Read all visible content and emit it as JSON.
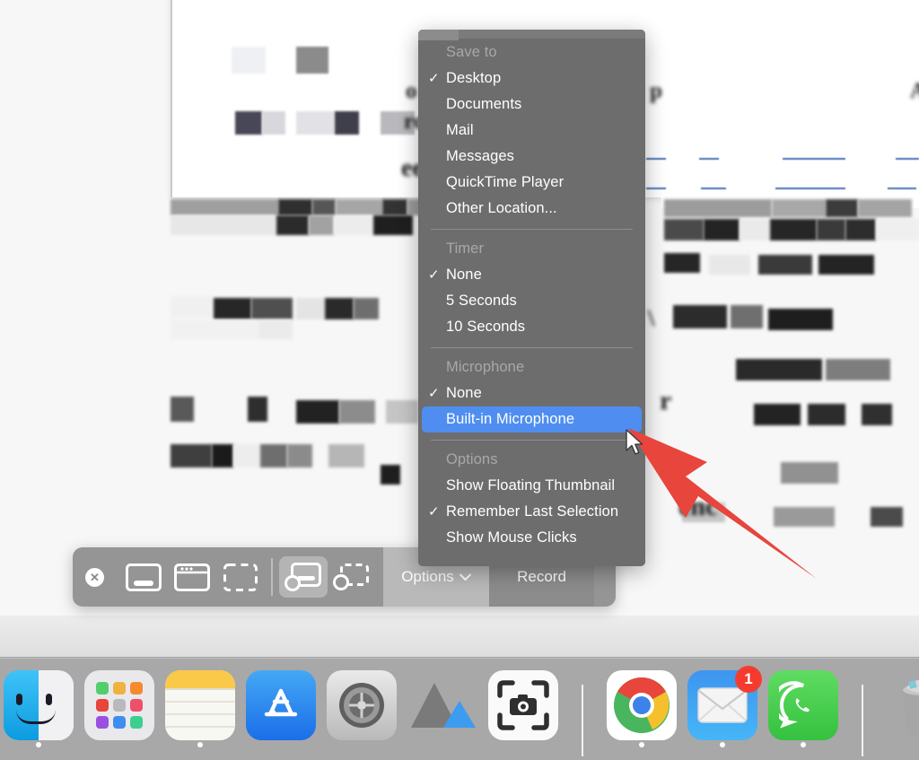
{
  "menu": {
    "sections": [
      {
        "title": "Save to",
        "items": [
          {
            "label": "Desktop",
            "checked": true
          },
          {
            "label": "Documents",
            "checked": false
          },
          {
            "label": "Mail",
            "checked": false
          },
          {
            "label": "Messages",
            "checked": false
          },
          {
            "label": "QuickTime Player",
            "checked": false
          },
          {
            "label": "Other Location...",
            "checked": false
          }
        ]
      },
      {
        "title": "Timer",
        "items": [
          {
            "label": "None",
            "checked": true
          },
          {
            "label": "5 Seconds",
            "checked": false
          },
          {
            "label": "10 Seconds",
            "checked": false
          }
        ]
      },
      {
        "title": "Microphone",
        "items": [
          {
            "label": "None",
            "checked": true
          },
          {
            "label": "Built-in Microphone",
            "checked": false,
            "highlighted": true
          }
        ]
      },
      {
        "title": "Options",
        "items": [
          {
            "label": "Show Floating Thumbnail",
            "checked": false
          },
          {
            "label": "Remember Last Selection",
            "checked": true
          },
          {
            "label": "Show Mouse Clicks",
            "checked": false
          }
        ]
      }
    ],
    "check_glyph": "✓",
    "highlight_color": "#4f8ef0",
    "background_color": "#6d6d6d"
  },
  "screenshot_toolbar": {
    "close_glyph": "✕",
    "tools": [
      {
        "name": "capture-entire-screen",
        "selected": false
      },
      {
        "name": "capture-selected-window",
        "selected": false
      },
      {
        "name": "capture-selected-portion",
        "selected": false
      },
      {
        "name": "record-entire-screen",
        "selected": true
      },
      {
        "name": "record-selected-portion",
        "selected": false
      }
    ],
    "options_label": "Options",
    "options_chevron": "⌄",
    "record_label": "Record"
  },
  "dock": {
    "items": [
      {
        "name": "finder",
        "label": "Finder",
        "running": true
      },
      {
        "name": "launchpad",
        "label": "Launchpad",
        "running": false
      },
      {
        "name": "notes",
        "label": "Notes",
        "running": true
      },
      {
        "name": "app-store",
        "label": "App Store",
        "running": false
      },
      {
        "name": "system-preferences",
        "label": "System Preferences",
        "running": false
      },
      {
        "name": "keynote",
        "label": "Keynote",
        "running": false
      },
      {
        "name": "screenshot",
        "label": "Screenshot",
        "running": false
      },
      {
        "name": "separator",
        "label": "",
        "running": false
      },
      {
        "name": "google-chrome",
        "label": "Google Chrome",
        "running": true
      },
      {
        "name": "mail",
        "label": "Mail",
        "running": true,
        "badge": "1"
      },
      {
        "name": "whatsapp",
        "label": "WhatsApp",
        "running": true
      },
      {
        "name": "separator",
        "label": "",
        "running": false
      },
      {
        "name": "trash",
        "label": "Trash",
        "running": false
      }
    ]
  },
  "annotation": {
    "arrow_color": "#e8453c",
    "points_to": "Built-in Microphone"
  },
  "background": {
    "description": "Blurred and pixelated redacted document content behind the menu"
  }
}
